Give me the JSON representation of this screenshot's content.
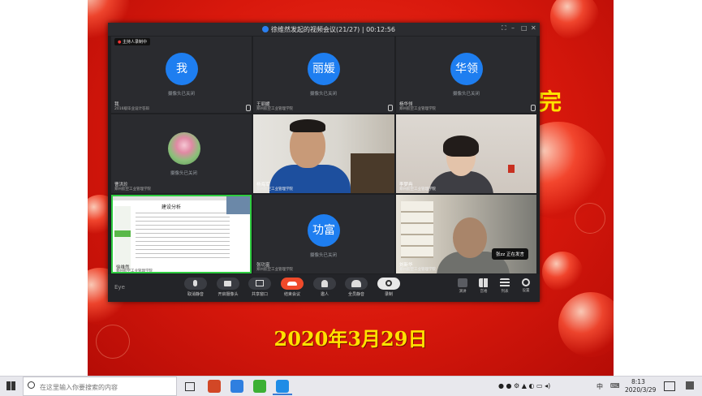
{
  "slide": {
    "date_text": "2020年3月29日",
    "partial_heading": "完"
  },
  "meeting": {
    "title": "徐维然发起的视频会议(21/27) | 00:12:56",
    "host_badge": "主持人录制中",
    "tiles": [
      {
        "avatar_text": "我",
        "status": "摄像头已关闭",
        "name": "我",
        "subtitle": "2016级毕业设计答辩"
      },
      {
        "avatar_text": "丽媛",
        "status": "摄像头已关闭",
        "name": "王丽媛",
        "subtitle": "郑州航空工业管理学院"
      },
      {
        "avatar_text": "华领",
        "status": "摄像头已关闭",
        "name": "杨华领",
        "subtitle": "郑州航空工业管理学院"
      },
      {
        "status": "摄像头已关闭",
        "name": "曹洪珍",
        "subtitle": "郑州航空工业管理学院"
      },
      {
        "name": "杨海军",
        "subtitle": "郑州航空工业管理学院"
      },
      {
        "name": "李梦冉",
        "subtitle": "郑州航空工业管理学院"
      },
      {
        "name": "徐维然",
        "subtitle": "郑州航空工业管理学院",
        "doc_heading": "建设分析"
      },
      {
        "avatar_text": "功富",
        "status": "摄像头已关闭",
        "name": "张功富",
        "subtitle": "郑州航空工业管理学院"
      },
      {
        "name": "刘新华",
        "subtitle": "郑州航空工业管理学院",
        "speaking_tag": "张zz  正在发言"
      }
    ],
    "toolbar": {
      "logo": "Eye",
      "buttons": [
        "取消静音",
        "开启摄像头",
        "共享窗口",
        "结束会议",
        "邀人",
        "全员静音",
        "录制"
      ],
      "right_buttons": [
        "演讲",
        "宫格",
        "列表",
        "设置"
      ]
    }
  },
  "taskbar": {
    "search_placeholder": "在这里输入你要搜索的内容",
    "tray_ime": "中",
    "time": "8:13",
    "date": "2020/3/29"
  }
}
